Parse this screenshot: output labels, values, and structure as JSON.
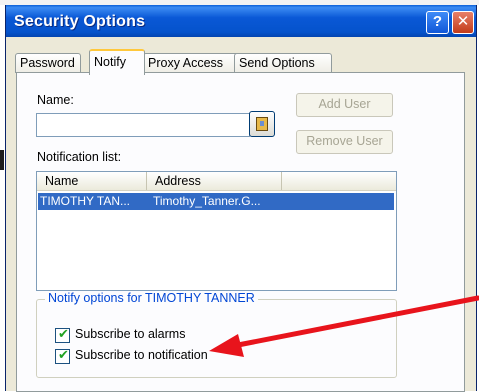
{
  "window": {
    "title": "Security Options",
    "help_glyph": "?",
    "close_glyph": "✕"
  },
  "tabs": [
    {
      "label": "Password"
    },
    {
      "label": "Notify"
    },
    {
      "label": "Proxy Access"
    },
    {
      "label": "Send Options"
    }
  ],
  "form": {
    "name_label": "Name:",
    "name_value": "",
    "add_user_label": "Add User",
    "remove_user_label": "Remove User",
    "notification_list_label": "Notification list:"
  },
  "list": {
    "columns": [
      "Name",
      "Address"
    ],
    "rows": [
      {
        "name": "TIMOTHY TAN...",
        "address": "Timothy_Tanner.G..."
      }
    ]
  },
  "notify_options": {
    "title": "Notify options for TIMOTHY TANNER",
    "subscribe_alarms_label": "Subscribe to alarms",
    "subscribe_alarms_checked": true,
    "subscribe_notification_label": "Subscribe to notification",
    "subscribe_notification_checked": true
  },
  "annotation": {
    "arrow_color": "#e8141c"
  },
  "colors": {
    "titlebar": "#0553cc",
    "selection": "#316ac5",
    "group_title": "#0046d5",
    "active_tab_accent": "#ffc83c"
  }
}
